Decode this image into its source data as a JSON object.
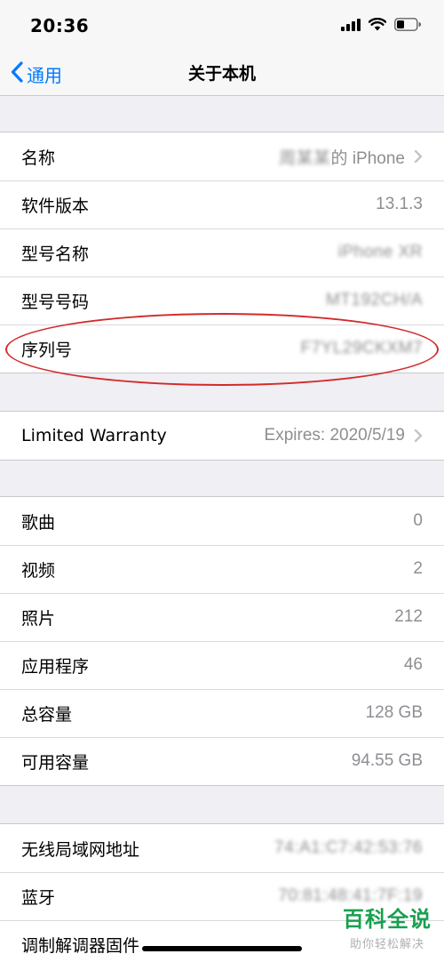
{
  "status_bar": {
    "time": "20:36"
  },
  "nav": {
    "back_label": "通用",
    "title": "关于本机"
  },
  "group1": [
    {
      "label": "名称",
      "value": "的 iPhone",
      "value_blurred_prefix": "周某某",
      "chevron": true
    },
    {
      "label": "软件版本",
      "value": "13.1.3"
    },
    {
      "label": "型号名称",
      "value": "iPhone XR",
      "blurred": true
    },
    {
      "label": "型号号码",
      "value": "MT192CH/A",
      "blurred": true
    },
    {
      "label": "序列号",
      "value": "F7YL29CKXM7",
      "blurred": true
    }
  ],
  "group2": [
    {
      "label": "Limited Warranty",
      "value": "Expires: 2020/5/19",
      "chevron": true
    }
  ],
  "group3": [
    {
      "label": "歌曲",
      "value": "0"
    },
    {
      "label": "视频",
      "value": "2"
    },
    {
      "label": "照片",
      "value": "212"
    },
    {
      "label": "应用程序",
      "value": "46"
    },
    {
      "label": "总容量",
      "value": "128 GB"
    },
    {
      "label": "可用容量",
      "value": "94.55 GB"
    }
  ],
  "group4": [
    {
      "label": "无线局域网地址",
      "value": "74:A1:C7:42:53:76",
      "blurred": true
    },
    {
      "label": "蓝牙",
      "value": "70:81:48:41:7F:19",
      "blurred": true
    },
    {
      "label": "调制解调器固件",
      "value": ""
    }
  ],
  "watermark": {
    "title": "百科全说",
    "subtitle": "助你轻松解决"
  },
  "colors": {
    "accent": "#007aff",
    "annotation": "#d32a2a",
    "watermark": "#18a04f"
  }
}
